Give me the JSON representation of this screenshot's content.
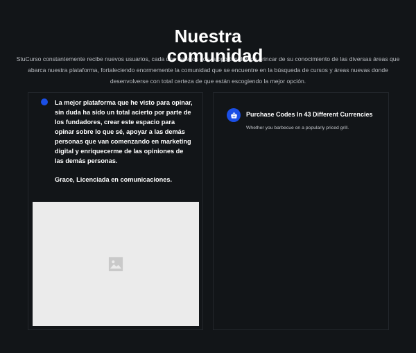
{
  "section": {
    "title_line1": "Nuestra",
    "title_line2": "comunidad",
    "intro": "StuCurso constantemente recibe nuevos usuarios, cada uno de ellos con la oportunidad de brincar de su conocimiento de las diversas áreas que abarca nuestra plataforma, fortaleciendo enormemente la comunidad que se encuentre en la búsqueda de cursos y áreas nuevas donde desenvolverse con total certeza de que están escogiendo la mejor opción."
  },
  "testimonial": {
    "quote": "La mejor plataforma que he visto para opinar, sin duda ha sido un total acierto por parte de los fundadores, crear este espacio para opinar sobre lo que sé, apoyar a las demás personas que van comenzando en marketing digital y enriquecerme de las opiniones de las demás personas.",
    "author": "Grace, Licenciada en comunicaciones.",
    "image_icon": "image-placeholder-icon"
  },
  "feature": {
    "icon": "basket-icon",
    "title": "Purchase Codes In 43 Different Currencies",
    "description": "Whether you barbecue on a popularly priced grill."
  },
  "colors": {
    "background": "#121518",
    "accent": "#1b4fe6",
    "card_border": "#23272c",
    "placeholder": "#ebebeb"
  }
}
